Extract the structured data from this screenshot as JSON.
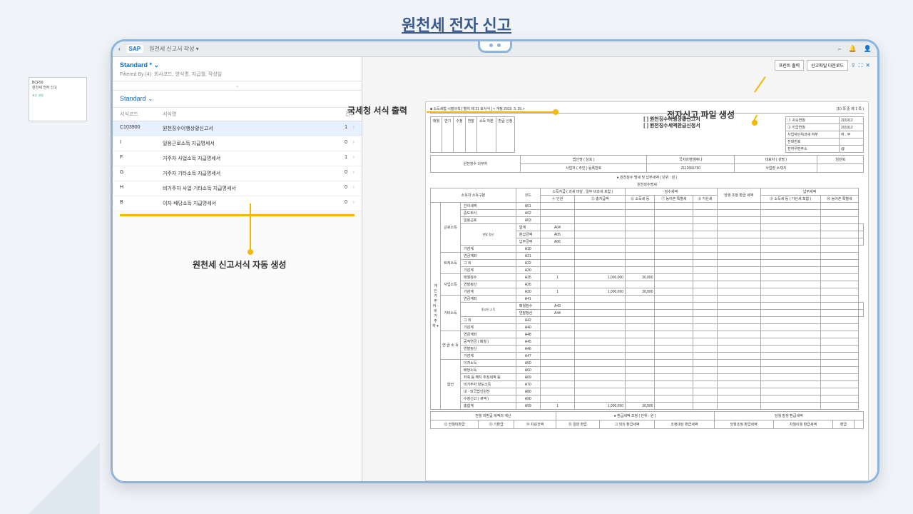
{
  "page": {
    "title": "원천세 전자 신고"
  },
  "thumbnail": {
    "code": "BCF50",
    "title": "원천세 전자 신고",
    "meta": "표준\n설명"
  },
  "sap_bar": {
    "breadcrumb": "원천세 신고서 작성 ▾"
  },
  "filters": {
    "standard": "Standard *",
    "filtered_by": "Filtered By (4): 회사코드, 양식명, 지급월, 작성일"
  },
  "list": {
    "standard": "Standard"
  },
  "table": {
    "head": {
      "c1": "서식코드",
      "c2": "서식명",
      "c3": "건수"
    },
    "rows": [
      {
        "c1": "C103900",
        "c2": "원천징수이행상황신고서",
        "c3": "1"
      },
      {
        "c1": "I",
        "c2": "일용근로소득 지급명세서",
        "c3": "0"
      },
      {
        "c1": "F",
        "c2": "거주자 사업소득 지급명세서",
        "c3": "1"
      },
      {
        "c1": "G",
        "c2": "거주자 기타소득 지급명세서",
        "c3": "0"
      },
      {
        "c1": "H",
        "c2": "비거주자 사업·기타소득 지급명세서",
        "c3": "0"
      },
      {
        "c1": "B",
        "c2": "이자·배당소득 지급명세서",
        "c3": "0"
      }
    ]
  },
  "callouts": {
    "auto_gen": "원천세 신고서식 자동 생성",
    "form_print": "국세청 서식 출력",
    "file_gen": "전자신고 파일 생성"
  },
  "toolbar": {
    "print": "프린트 출력",
    "download": "신고파일 다운로드"
  },
  "doc": {
    "topleft": "■ 소득세법 시행규칙 [ 별지 제 21 호서식 ] < 개정  2019. 3. 20.>",
    "topright": "(10 쪽 중 제 1 쪽 )",
    "title1": "[ ] 원천징수이행상황신고서",
    "title2": "[ ] 원천징수세액환급신청서",
    "cells": {
      "c1": "매월",
      "c2": "반기",
      "c3": "수정",
      "c4": "연말",
      "c5": "소득\n처분",
      "c6": "환급\n신청"
    },
    "meta": {
      "r1a": "① 귀속연월",
      "r1b": "201912",
      "r2a": "② 지급연월",
      "r2b": "201912",
      "r3a": "사업자단위과세 여부",
      "r3b": "여 , 부",
      "r4a": "전화번호",
      "r4b": "",
      "r5a": "전자우편주소",
      "r5b": "@"
    },
    "info": {
      "l1": "원천징수\n의무자",
      "l2a": "법인명 ( 상호 )",
      "l2b": "국치비엔엠㈜나",
      "l3a": "대표자 ( 성명 )",
      "l3b": "임민복",
      "l4a": "사업자 ( 주민 )\n등록번호",
      "l4b": "2112666790",
      "l5a": "사업장 소재지",
      "l5b": ""
    },
    "section1": "● 원천징수 명세 및 납부세액 ( 단위 : 원 )",
    "section2": "원천징수명세",
    "headers": {
      "h1": "소득자 소득구분",
      "h2": "코드",
      "h3": "소득지급\n( 과세 미달 , 일부 비과세 포함 )",
      "h4": "징수세액",
      "h5": "당월 조정 환급\n세액",
      "h6": "납부세액",
      "sh3a": "④ 인원",
      "sh3b": "⑤ 총지급액",
      "sh4a": "⑥ 소득세 등",
      "sh4b": "⑦ 농어촌\n특별세",
      "sh4c": "⑧\n가산세",
      "sh6a": "⑨ 소득세 등\n( 가산세 포함 )",
      "sh6b": "⑩\n농어촌\n특별세"
    },
    "rowgroups": {
      "g1": "개\n인\n\n거주자 ·\n비거주자\n▾",
      "g2a": "근로소득",
      "g2b": "퇴직소득",
      "g2c": "사업소득",
      "g2d": "기타소득",
      "g3": "연\n금\n소\n득",
      "g4": "합산",
      "sub": "연말\n정산"
    },
    "rows": [
      {
        "n": "간이세액",
        "k": "A01"
      },
      {
        "n": "중도퇴사",
        "k": "A02"
      },
      {
        "n": "일용근로",
        "k": "A03"
      },
      {
        "n": "합계",
        "k": "A04"
      },
      {
        "n": "분납금액",
        "k": "A05"
      },
      {
        "n": "납부금액",
        "k": "A06"
      },
      {
        "n": "가감계",
        "k": "A10"
      },
      {
        "n": "연금계좌",
        "k": "A21"
      },
      {
        "n": "그 외",
        "k": "A22"
      },
      {
        "n": "가감계",
        "k": "A20"
      },
      {
        "n": "매월징수",
        "k": "A25",
        "p": "1",
        "amt": "1,000,000",
        "tax": "30,000"
      },
      {
        "n": "연말정산",
        "k": "A26"
      },
      {
        "n": "가감계",
        "k": "A30",
        "p": "1",
        "amt": "1,000,000",
        "tax": "30,000"
      },
      {
        "n": "연금계좌",
        "k": "A41"
      },
      {
        "n": "매월징수",
        "k": "A43"
      },
      {
        "n": "연말정산",
        "k": "A44"
      },
      {
        "n": "그 외",
        "k": "A42"
      },
      {
        "n": "가감계",
        "k": "A40"
      },
      {
        "n": "연금계좌",
        "k": "A48"
      },
      {
        "n": "공적연금 ( 매월 )",
        "k": "A45"
      },
      {
        "n": "연말정산",
        "k": "A46"
      },
      {
        "n": "가감계",
        "k": "A47"
      },
      {
        "n": "이자소득",
        "k": "A50"
      },
      {
        "n": "배당소득",
        "k": "A60"
      },
      {
        "n": "저축 등 해지 추징세액 등",
        "k": "A69"
      },
      {
        "n": "비거주자 양도소득",
        "k": "A70"
      },
      {
        "n": "내 · 외국법인원천",
        "k": "A80"
      },
      {
        "n": "수정신고 ( 세액 )",
        "k": "A90"
      },
      {
        "n": "총합계",
        "k": "A99",
        "p": "1",
        "amt": "1,000,000",
        "tax": "30,000"
      }
    ],
    "footer": {
      "l": "전월  미환급 세액의 계산",
      "c": "● 환급세액 조정 ( 단위 : 원 )",
      "r": "당월 발생 환급세액",
      "t1": "⑫ 전월미환급",
      "t2": "⑬ 기환급",
      "t3": "⑭ 차감잔액",
      "t4": "⑮ 일반\n환급",
      "t5": "그 외의 환급세액",
      "t6": "조정대상\n환급세액",
      "t7": "당월조정 환급세액",
      "t8": "차월이월 환급세액",
      "t9": "환급"
    }
  }
}
